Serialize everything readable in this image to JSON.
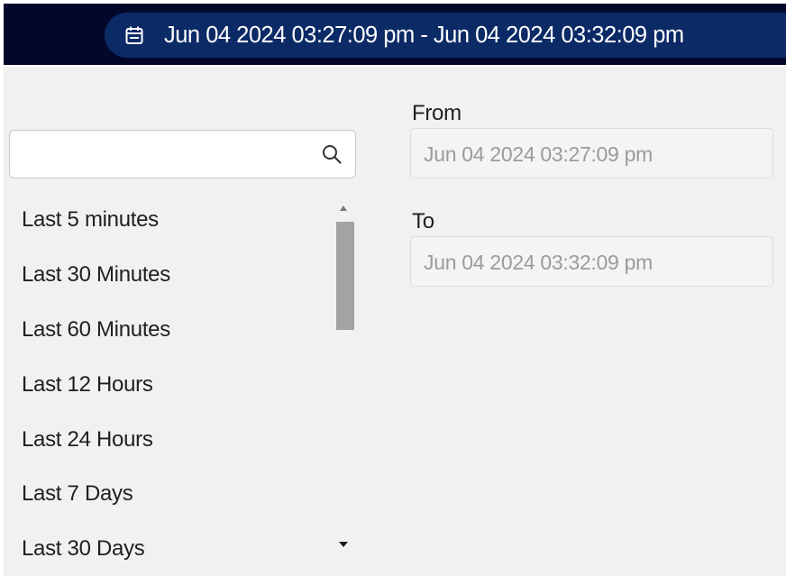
{
  "header": {
    "date_range": "Jun 04 2024 03:27:09 pm - Jun 04 2024 03:32:09 pm",
    "icon": "calendar-icon",
    "bar_color": "#03082b",
    "pill_color": "#0b2a66"
  },
  "search": {
    "value": "",
    "placeholder": "",
    "icon": "search-icon"
  },
  "quick_ranges": [
    {
      "label": "Last 5 minutes"
    },
    {
      "label": "Last 30 Minutes"
    },
    {
      "label": "Last 60 Minutes"
    },
    {
      "label": "Last 12 Hours"
    },
    {
      "label": "Last 24 Hours"
    },
    {
      "label": "Last 7 Days"
    },
    {
      "label": "Last 30 Days"
    }
  ],
  "from": {
    "label": "From",
    "placeholder": "Jun 04 2024 03:27:09 pm"
  },
  "to": {
    "label": "To",
    "placeholder": "Jun 04 2024 03:32:09 pm"
  }
}
